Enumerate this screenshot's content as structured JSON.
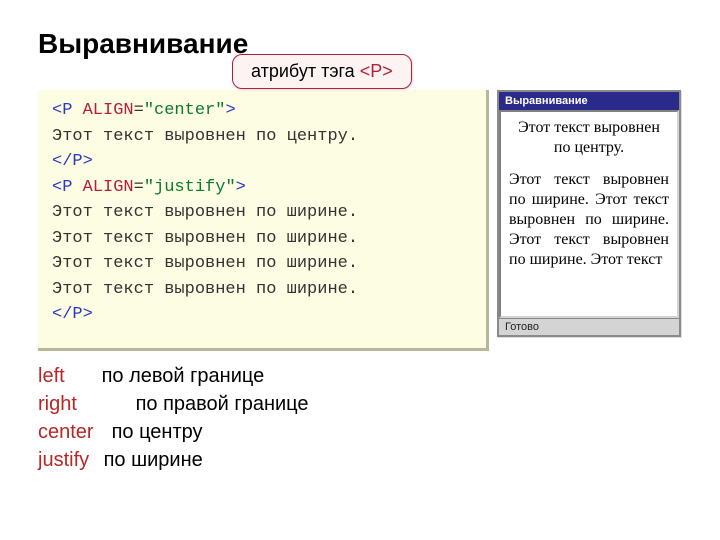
{
  "title": "Выравнивание",
  "badge": {
    "label": "атрибут тэга ",
    "tag": "<P>"
  },
  "code": {
    "l1_open": "<",
    "l1_tag": "P",
    "l1_attr": " ALIGN",
    "l1_eq": "=",
    "l1_val": "\"center\"",
    "l1_close": ">",
    "l2": "Этот текст выровнен по центру.",
    "l3_open": "</",
    "l3_tag": "P",
    "l3_close": ">",
    "l4_open": "<",
    "l4_tag": "P",
    "l4_attr": " ALIGN",
    "l4_eq": "=",
    "l4_val": "\"justify\"",
    "l4_close": ">",
    "l5": "Этот текст выровнен по ширине.",
    "l6": "Этот текст выровнен по ширине.",
    "l7": "Этот текст выровнен по ширине.",
    "l8": "Этот текст выровнен по ширине.",
    "l9_open": "</",
    "l9_tag": "P",
    "l9_close": ">"
  },
  "legend": [
    {
      "kw": "left",
      "desc": "по левой границе"
    },
    {
      "kw": "right",
      "desc": "по правой границе"
    },
    {
      "kw": "center",
      "desc": "по центру"
    },
    {
      "kw": "justify",
      "desc": "по ширине"
    }
  ],
  "window": {
    "title": "Выравнивание",
    "center_text": "Этот текст выровнен по центру.",
    "justify_text": "Этот текст выровнен по ширине. Этот текст выровнен по ширине. Этот текст выровнен по ширине. Этот текст",
    "status": "Готово"
  }
}
